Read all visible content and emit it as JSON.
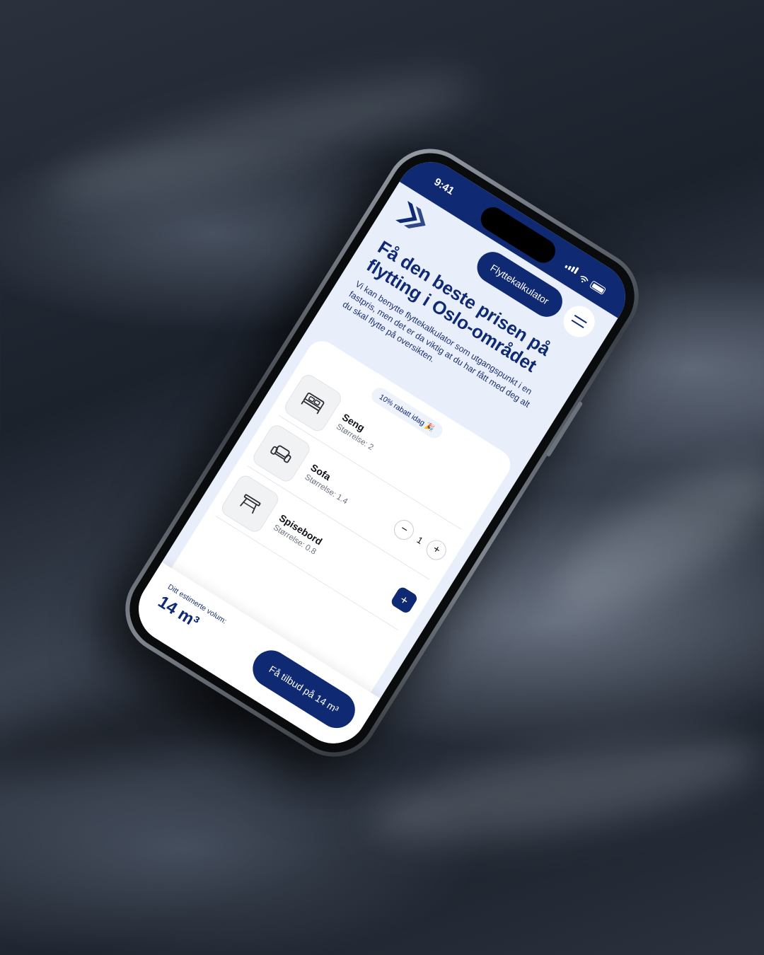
{
  "status_bar": {
    "time": "9:41"
  },
  "nav": {
    "cta_label": "Flyttekalkulator"
  },
  "hero": {
    "title": "Få den beste prisen på flytting i Oslo-området",
    "description": "Vi kan benytte flyttekalkulator som utgangspunkt i en fastpris, men det er da viktig at du har fått med deg alt du skal flytte på oversikten."
  },
  "badge": "10% rabatt idag 🎉",
  "items": [
    {
      "name": "Seng",
      "size": "Størrelse: 2",
      "icon": "bed-icon"
    },
    {
      "name": "Sofa",
      "size": "Størrelse: 1.4",
      "icon": "sofa-icon",
      "quantity": "1"
    },
    {
      "name": "Spisebord",
      "size": "Størrelse: 0.8",
      "icon": "table-icon"
    }
  ],
  "controls": {
    "minus": "−",
    "plus": "+"
  },
  "footer": {
    "volume_label": "Ditt estimerte volum:",
    "volume_value": "14 m³",
    "quote_label": "Få tilbud på 14 m³"
  },
  "colors": {
    "brand": "#0f2a73",
    "screen_bg": "#e9effa"
  }
}
